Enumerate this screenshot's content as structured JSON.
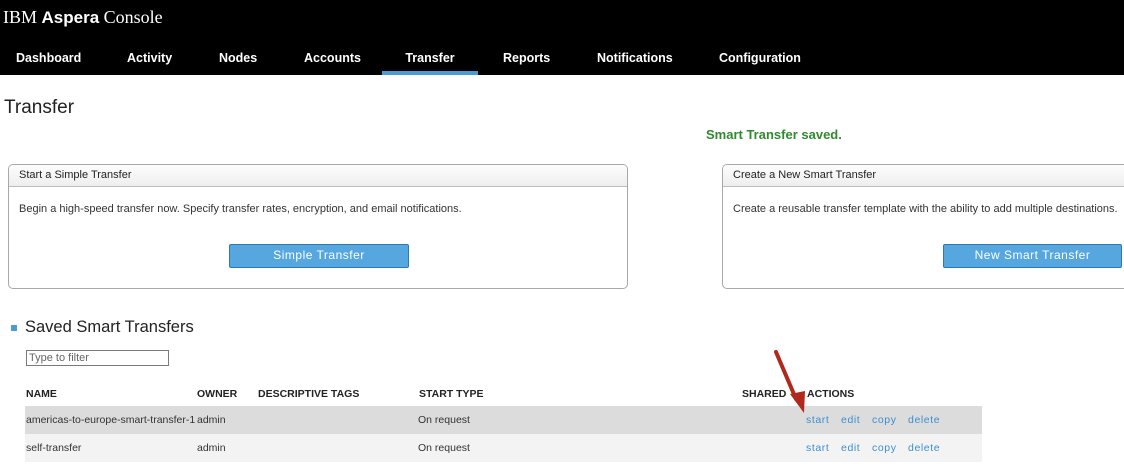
{
  "header": {
    "brand": {
      "prefix": "IBM",
      "bold": "Aspera",
      "suffix": "Console"
    },
    "nav": [
      {
        "label": "Dashboard"
      },
      {
        "label": "Activity"
      },
      {
        "label": "Nodes"
      },
      {
        "label": "Accounts"
      },
      {
        "label": "Transfer",
        "active": true
      },
      {
        "label": "Reports"
      },
      {
        "label": "Notifications"
      },
      {
        "label": "Configuration"
      }
    ]
  },
  "page": {
    "title": "Transfer",
    "status_message": "Smart Transfer saved."
  },
  "panels": {
    "simple": {
      "header": "Start a Simple Transfer",
      "description": "Begin a high-speed transfer now. Specify transfer rates, encryption, and email notifications.",
      "button": "Simple Transfer"
    },
    "smart": {
      "header": "Create a New Smart Transfer",
      "description": "Create a reusable transfer template with the ability to add multiple destinations.",
      "button": "New Smart Transfer"
    }
  },
  "saved": {
    "title": "Saved Smart Transfers",
    "filter_placeholder": "Type to filter",
    "columns": {
      "name": "NAME",
      "owner": "OWNER",
      "tags": "DESCRIPTIVE TAGS",
      "start_type": "START TYPE",
      "shared": "SHARED",
      "actions": "ACTIONS"
    },
    "rows": [
      {
        "name": "americas-to-europe-smart-transfer-1",
        "owner": "admin",
        "tags": "",
        "start_type": "On request",
        "shared": "",
        "actions": {
          "start": "start",
          "edit": "edit",
          "copy": "copy",
          "delete": "delete"
        }
      },
      {
        "name": "self-transfer",
        "owner": "admin",
        "tags": "",
        "start_type": "On request",
        "shared": "",
        "actions": {
          "start": "start",
          "edit": "edit",
          "copy": "copy",
          "delete": "delete"
        }
      }
    ]
  },
  "colors": {
    "topbar": "#000000",
    "accent": "#4b9bd6",
    "button": "#56a7df",
    "success": "#2e8b2e",
    "link": "#3b8fd0",
    "annotation_arrow": "#b0291c"
  },
  "annotation": {
    "icon": "red-arrow-icon"
  }
}
